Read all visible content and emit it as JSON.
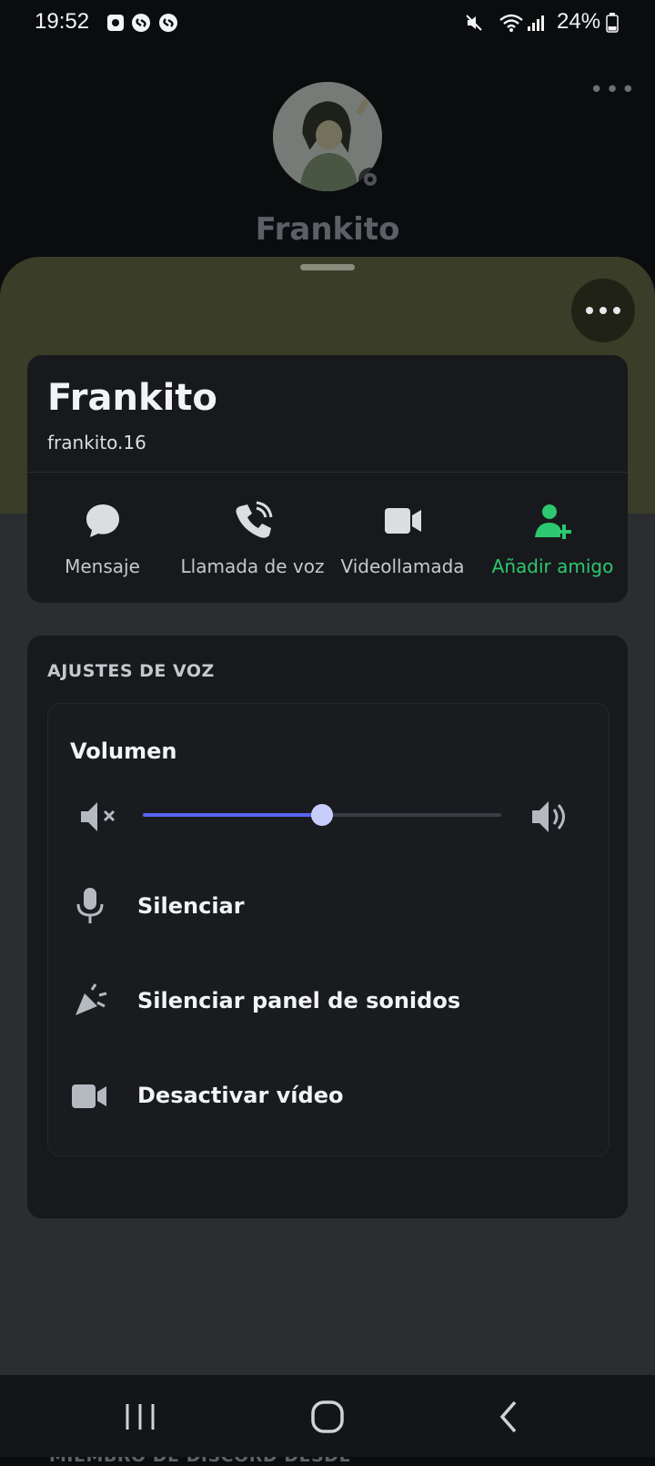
{
  "status_bar": {
    "time": "19:52",
    "battery": "24%",
    "left_icons": [
      "notification-icon",
      "shazam-icon",
      "shazam-icon"
    ],
    "right_icons": [
      "mute-icon",
      "wifi-icon",
      "signal-icon",
      "battery-icon"
    ]
  },
  "background_header": {
    "name": "Frankito",
    "more_icon": "more-icon"
  },
  "profile": {
    "display_name": "Frankito",
    "username": "frankito.16",
    "status": "offline",
    "banner_color": "#3a3d27"
  },
  "actions": [
    {
      "label": "Mensaje",
      "icon": "message-icon"
    },
    {
      "label": "Llamada de voz",
      "icon": "phone-icon"
    },
    {
      "label": "Videollamada",
      "icon": "video-icon"
    },
    {
      "label": "Añadir amigo",
      "icon": "add-friend-icon",
      "color": "#2dc770"
    }
  ],
  "voice_settings": {
    "title": "AJUSTES DE VOZ",
    "volume_label": "Volumen",
    "volume_level": 0.5,
    "accent_color": "#5865f2",
    "rows": [
      {
        "label": "Silenciar",
        "icon": "microphone-icon"
      },
      {
        "label": "Silenciar panel de sonidos",
        "icon": "soundboard-icon"
      },
      {
        "label": "Desactivar vídeo",
        "icon": "video-icon"
      }
    ]
  },
  "next_section_title": "MIEMBRO DE DISCORD DESDE",
  "nav_bar": [
    "recent-apps-icon",
    "home-icon",
    "back-icon"
  ]
}
